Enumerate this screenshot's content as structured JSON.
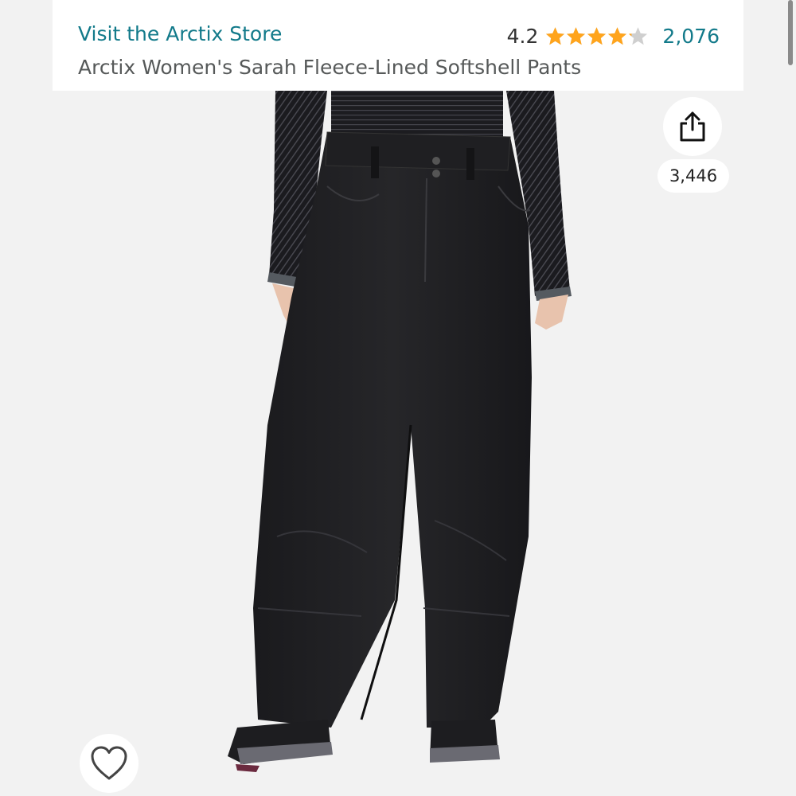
{
  "header": {
    "store_link": "Visit the Arctix Store",
    "rating": "4.2",
    "stars_filled": 4.2,
    "stars_total": 5,
    "review_count": "2,076",
    "product_title": "Arctix Women's Sarah Fleece-Lined Softshell Pants"
  },
  "actions": {
    "share_icon": "share-icon",
    "share_count": "3,446",
    "wishlist_icon": "heart-outline-icon"
  },
  "colors": {
    "link": "#127a8a",
    "star": "#ffa41c",
    "star_empty": "#cfcfcf",
    "background": "#f2f2f2"
  }
}
